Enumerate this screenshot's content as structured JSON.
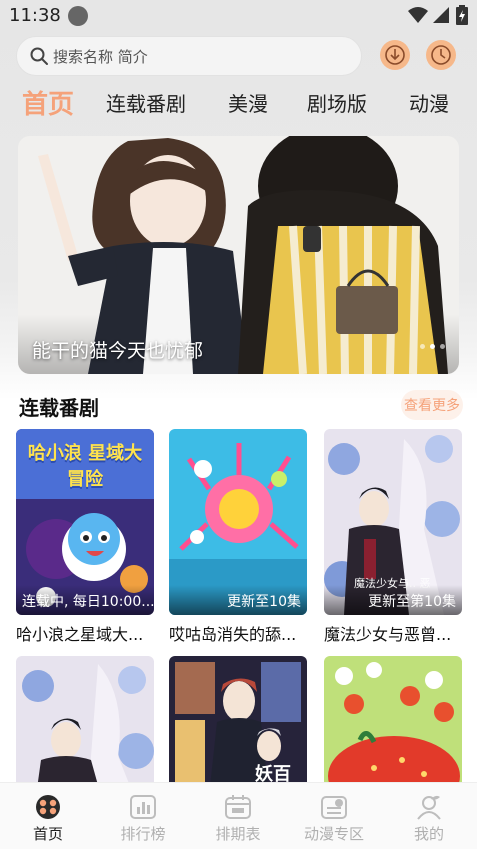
{
  "status_bar": {
    "time": "11:38"
  },
  "search": {
    "placeholder": "搜索名称 简介"
  },
  "tabs": [
    {
      "label": "首页",
      "active": true
    },
    {
      "label": "连载番剧"
    },
    {
      "label": "美漫"
    },
    {
      "label": "剧场版"
    },
    {
      "label": "动漫"
    }
  ],
  "banner": {
    "title": "能干的猫今天也忧郁"
  },
  "section": {
    "title": "连载番剧",
    "more_label": "查看更多"
  },
  "cards_row1": [
    {
      "name": "哈小浪之星域大...",
      "badge": "连载中, 每日10:00...",
      "cover_text": "哈小浪 星域大冒险"
    },
    {
      "name": "哎咕岛消失的舔...",
      "badge": "更新至10集"
    },
    {
      "name": "魔法少女与恶曾...",
      "badge": "更新至第10集",
      "cover_text": "魔法少女与.. 恶"
    }
  ],
  "cards_row2": [
    {
      "name": ""
    },
    {
      "name": "",
      "cover_text": "妖百"
    },
    {
      "name": ""
    }
  ],
  "bottom_nav": [
    {
      "label": "首页",
      "active": true
    },
    {
      "label": "排行榜"
    },
    {
      "label": "排期表"
    },
    {
      "label": "动漫专区"
    },
    {
      "label": "我的"
    }
  ],
  "colors": {
    "accent": "#f5a27a",
    "icon_bg": "#f6b88a",
    "nav_inactive": "#b0b0b0"
  }
}
